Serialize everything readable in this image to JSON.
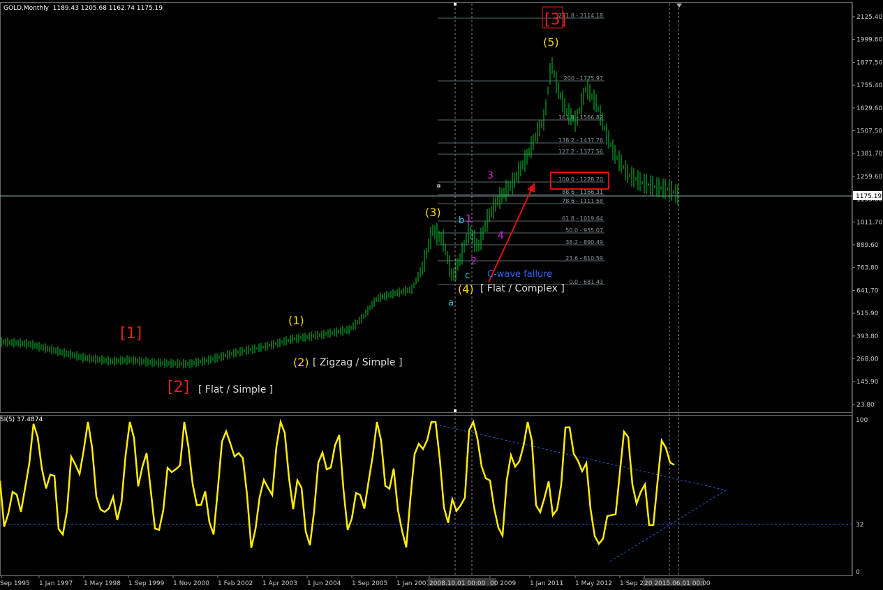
{
  "header": {
    "symbol_title": "GOLD,Monthly",
    "ohlc": "1189.43 1205.68 1162.74 1175.19"
  },
  "rsi_header": "SI(5) 37.4874",
  "price_axis": [
    "2125.40",
    "1999.60",
    "1877.50",
    "1755.40",
    "1629.60",
    "1507.50",
    "1381.70",
    "1259.60",
    "1133.80",
    "1011.70",
    "889.60",
    "763.80",
    "641.70",
    "515.90",
    "393.80",
    "268.00",
    "145.90",
    "23.80"
  ],
  "current_price_label": "1175.19",
  "rsi_axis": [
    "100",
    "32",
    "0"
  ],
  "time_axis": [
    "Sep 1995",
    "1 Jan 1997",
    "1 May 1998",
    "1 Sep 1999",
    "1 Nov 2000",
    "1 Feb 2002",
    "1 Apr 2003",
    "1 Jun 2004",
    "1 Sep 2005",
    "1 Jan 2007",
    "2008.10.01 00:00",
    "00 2009",
    "1 Jan 2011",
    "1 May 2012",
    "1 Sep 20",
    "20 2015.06.01 00:00"
  ],
  "fib_levels": [
    "261.8 - 2114.18",
    "200 - 1775.97",
    "161.8 - 1566.82",
    "138.2 - 1437.76",
    "127.2 - 1377.56",
    "100.0 - 1228.70",
    "88.6 - 1166.31",
    "78.6 - 1111.58",
    "61.8 - 1019.64",
    "50.0 - 955.07",
    "38.2 - 890.49",
    "23.6 - 810.59",
    "0.0 - 681.43"
  ],
  "wave_labels": {
    "w1_red": "[1]",
    "w2_red": "[2]",
    "w2_desc": "[ Flat / Simple ]",
    "w3_red": "[3]",
    "y1": "(1)",
    "y2": "(2)",
    "y2_desc": "[ Zigzag / Simple ]",
    "y3": "(3)",
    "y4": "(4)",
    "y4_desc": "[ Flat / Complex ]",
    "y5": "(5)",
    "m1": "1",
    "m2": "2",
    "m3": "3",
    "m4": "4",
    "a": "a",
    "b": "b",
    "c": "c",
    "c_wave_failure": "C-wave failure"
  },
  "colors": {
    "background": "#000000",
    "candles": "#00cc33",
    "rsi_line": "#ffee00",
    "wave_red": "#e02020",
    "wave_yellow": "#f5d400",
    "wave_magenta": "#e020e0",
    "wave_cyan": "#33d0e8",
    "trendline": "#3366ee",
    "fib": "#708090"
  }
}
